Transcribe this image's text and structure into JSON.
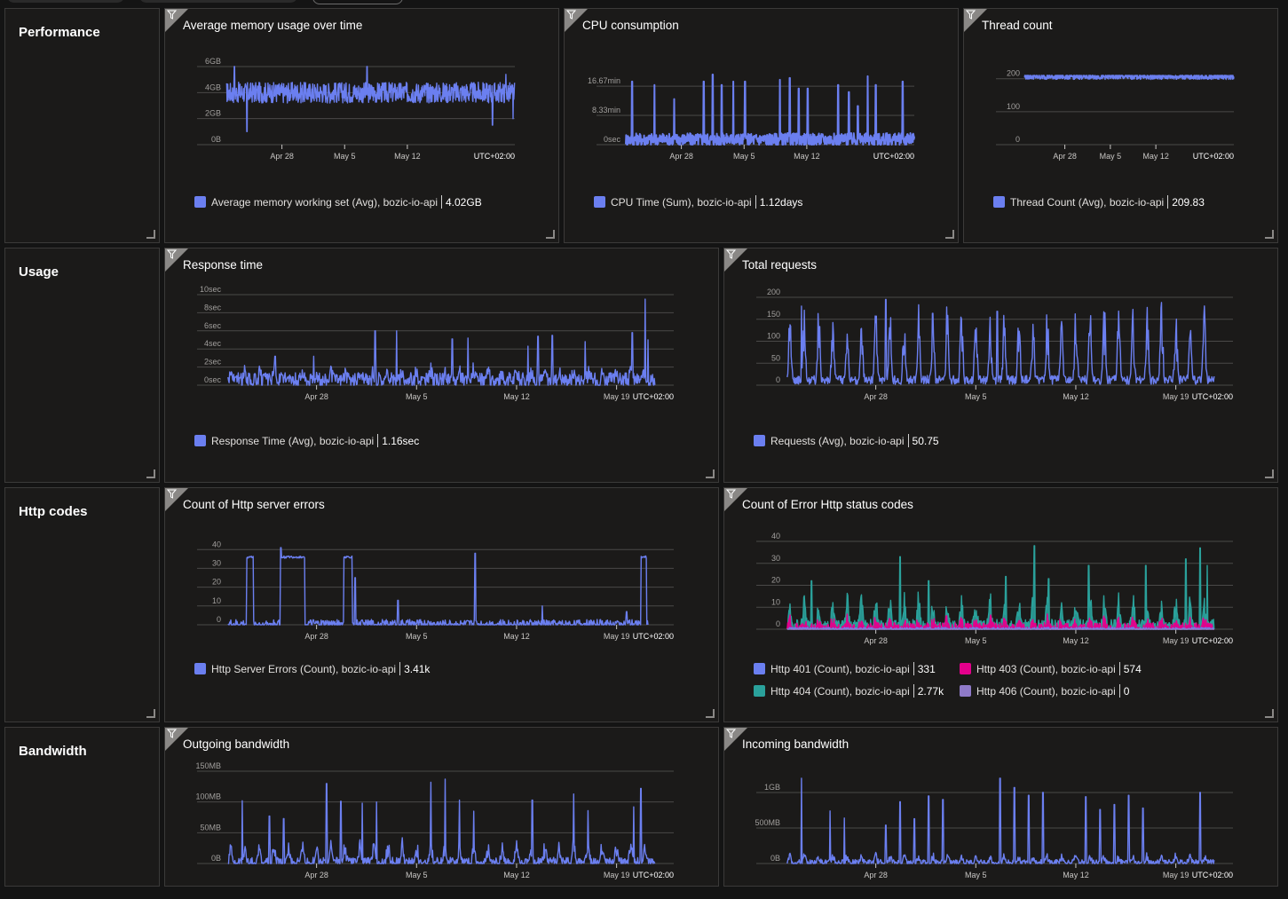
{
  "colors": {
    "series_blue": "#6b7ff0",
    "series_teal": "#2aa19b",
    "series_magenta": "#e3008c",
    "series_purple": "#8f7ac8",
    "gridline": "#4a4948",
    "panel_bg": "#1b1a19"
  },
  "sections": [
    {
      "label": "Performance"
    },
    {
      "label": "Usage"
    },
    {
      "label": "Http codes"
    },
    {
      "label": "Bandwidth"
    }
  ],
  "common": {
    "timezone_label": "UTC+02:00",
    "resource": "bozic-io-api",
    "filter_icon": "filter-icon",
    "resize_icon": "resize-handle-icon"
  },
  "chart_data": [
    {
      "id": "memory",
      "type": "line",
      "title": "Average memory usage over time",
      "xlabel": "",
      "ylabel": "",
      "x_ticks": [
        "Apr 28",
        "May 5",
        "May 12"
      ],
      "y_ticks": [
        "0B",
        "2GB",
        "4GB",
        "6GB"
      ],
      "ylim": [
        0,
        6
      ],
      "y_unit": "GB",
      "x_range_days": [
        0,
        31
      ],
      "x_tick_days": [
        6,
        13,
        20
      ],
      "legend_position": "bottom-left",
      "grid": true,
      "series": [
        {
          "name": "Average memory working set (Avg), bozic-io-api",
          "summary": "4.02GB",
          "color": "#6b7ff0",
          "profile": {
            "baseline": 4.0,
            "noise": 0.8,
            "spikes": [
              [
                1.2,
                6.3
              ],
              [
                2.6,
                1.0
              ],
              [
                16,
                6.3
              ],
              [
                30,
                1.5
              ],
              [
                31.5,
                5.4
              ],
              [
                32.3,
                2.0
              ]
            ],
            "end_day": 32.5
          }
        }
      ]
    },
    {
      "id": "cpu",
      "type": "line",
      "title": "CPU consumption",
      "x_ticks": [
        "Apr 28",
        "May 5",
        "May 12"
      ],
      "y_ticks": [
        "0sec",
        "8.33min",
        "16.67min"
      ],
      "ylim": [
        0,
        21
      ],
      "y_unit": "min",
      "x_tick_days": [
        6,
        13,
        20
      ],
      "legend_position": "bottom-left",
      "grid": true,
      "series": [
        {
          "name": "CPU Time (Sum), bozic-io-api",
          "summary": "1.12days",
          "color": "#6b7ff0",
          "profile": {
            "baseline": 1.5,
            "noise": 1.8,
            "spikes": [
              [
                1,
                18
              ],
              [
                3.5,
                17
              ],
              [
                5.7,
                13
              ],
              [
                9,
                18
              ],
              [
                10,
                20
              ],
              [
                11,
                17
              ],
              [
                12.3,
                18
              ],
              [
                13.6,
                18
              ],
              [
                17.5,
                18.5
              ],
              [
                18.6,
                19
              ],
              [
                19.6,
                16
              ],
              [
                20.6,
                16
              ],
              [
                24,
                17
              ],
              [
                25.2,
                15
              ],
              [
                26.2,
                11
              ],
              [
                27.3,
                19.5
              ],
              [
                28.2,
                17
              ],
              [
                31.2,
                18
              ]
            ],
            "end_day": 32.5
          }
        }
      ]
    },
    {
      "id": "threads",
      "type": "line",
      "title": "Thread count",
      "x_ticks": [
        "Apr 28",
        "May 5",
        "May 12"
      ],
      "y_ticks": [
        "0",
        "100",
        "200"
      ],
      "ylim": [
        0,
        210
      ],
      "x_tick_days": [
        6,
        13,
        20
      ],
      "legend_position": "bottom-left",
      "grid": true,
      "series": [
        {
          "name": "Thread Count (Avg), bozic-io-api",
          "summary": "209.83",
          "color": "#6b7ff0",
          "profile": {
            "baseline": 206,
            "noise": 8,
            "spikes": [],
            "end_day": 32.5
          }
        }
      ]
    },
    {
      "id": "response",
      "type": "line",
      "title": "Response time",
      "x_ticks": [
        "Apr 28",
        "May 5",
        "May 12",
        "May 19"
      ],
      "y_ticks": [
        "0sec",
        "2sec",
        "4sec",
        "6sec",
        "8sec",
        "10sec"
      ],
      "ylim": [
        0,
        10
      ],
      "y_unit": "sec",
      "x_tick_days": [
        6,
        13,
        20,
        27
      ],
      "legend_position": "bottom-left",
      "grid": true,
      "series": [
        {
          "name": "Response Time (Avg), bozic-io-api",
          "summary": "1.16sec",
          "color": "#6b7ff0",
          "profile": {
            "baseline": 0.6,
            "noise": 0.8,
            "spikes": [
              [
                3.6,
                3.2
              ],
              [
                6.3,
                3.2
              ],
              [
                10.6,
                6.0
              ],
              [
                12.1,
                6.0
              ],
              [
                16,
                5.1
              ],
              [
                17.1,
                5.2
              ],
              [
                21.3,
                4.3
              ],
              [
                22,
                5.4
              ],
              [
                23,
                5.5
              ],
              [
                25.3,
                4.8
              ],
              [
                28.6,
                5.8
              ],
              [
                29.5,
                9.5
              ],
              [
                29.7,
                5.0
              ]
            ],
            "daily_amp": 1.0,
            "end_day": 30.2
          }
        }
      ]
    },
    {
      "id": "requests",
      "type": "line",
      "title": "Total requests",
      "x_ticks": [
        "Apr 28",
        "May 5",
        "May 12",
        "May 19"
      ],
      "y_ticks": [
        "0",
        "50",
        "100",
        "150",
        "200"
      ],
      "ylim": [
        0,
        200
      ],
      "x_tick_days": [
        6,
        13,
        20,
        27
      ],
      "legend_position": "bottom-left",
      "grid": true,
      "series": [
        {
          "name": "Requests (Avg), bozic-io-api",
          "summary": "50.75",
          "color": "#6b7ff0",
          "profile": {
            "baseline": 12,
            "noise": 10,
            "daily_amp": 150,
            "spikes": [
              [
                1.3,
                180
              ],
              [
                7.2,
                195
              ],
              [
                15,
                168
              ]
            ],
            "end_day": 30.2
          }
        }
      ]
    },
    {
      "id": "server_errors",
      "type": "line",
      "title": "Count of Http server errors",
      "x_ticks": [
        "Apr 28",
        "May 5",
        "May 12",
        "May 19"
      ],
      "y_ticks": [
        "0",
        "10",
        "20",
        "30",
        "40"
      ],
      "ylim": [
        0,
        42
      ],
      "x_tick_days": [
        6,
        13,
        20,
        27
      ],
      "legend_position": "bottom-left",
      "grid": true,
      "series": [
        {
          "name": "Http Server Errors (Count), bozic-io-api",
          "summary": "3.41k",
          "color": "#6b7ff0",
          "profile": {
            "baseline": 0.3,
            "noise": 2.5,
            "plateaus": [
              [
                1.6,
                2.1,
                36
              ],
              [
                4.0,
                5.7,
                36
              ],
              [
                8.4,
                9.0,
                36
              ],
              [
                29.2,
                29.6,
                36
              ]
            ],
            "spikes": [
              [
                4.0,
                41
              ],
              [
                9.2,
                25
              ],
              [
                12.2,
                13
              ],
              [
                17.6,
                38
              ],
              [
                22.3,
                10
              ],
              [
                28.2,
                7
              ]
            ],
            "end_day": 29.7
          }
        }
      ]
    },
    {
      "id": "error_codes",
      "type": "line",
      "title": "Count of Error Http status codes",
      "x_ticks": [
        "Apr 28",
        "May 5",
        "May 12",
        "May 19"
      ],
      "y_ticks": [
        "0",
        "10",
        "20",
        "30",
        "40"
      ],
      "ylim": [
        0,
        40
      ],
      "x_tick_days": [
        6,
        13,
        20,
        27
      ],
      "legend_position": "bottom-left",
      "grid": true,
      "series": [
        {
          "name": "Http 401 (Count), bozic-io-api",
          "summary": "331",
          "color": "#6b7ff0",
          "profile": {
            "baseline": 0.2,
            "noise": 0.6,
            "spikes": [],
            "end_day": 30.2
          }
        },
        {
          "name": "Http 403 (Count), bozic-io-api",
          "summary": "574",
          "color": "#e3008c",
          "profile": {
            "baseline": 0.4,
            "noise": 2.5,
            "daily_amp": 4,
            "spikes": [],
            "end_day": 30.2
          }
        },
        {
          "name": "Http 404 (Count), bozic-io-api",
          "summary": "2.77k",
          "color": "#2aa19b",
          "profile": {
            "baseline": 1.5,
            "noise": 3,
            "daily_amp": 12,
            "spikes": [
              [
                8.2,
                33
              ],
              [
                17.6,
                38
              ],
              [
                18.6,
                23
              ],
              [
                15.6,
                24
              ],
              [
                29.2,
                37
              ],
              [
                28.2,
                32
              ],
              [
                29.7,
                29
              ],
              [
                21.4,
                29
              ],
              [
                25.4,
                29
              ],
              [
                2.0,
                22
              ],
              [
                10.2,
                22
              ]
            ],
            "end_day": 30.2
          }
        },
        {
          "name": "Http 406 (Count), bozic-io-api",
          "summary": "0",
          "color": "#8f7ac8",
          "profile": {
            "baseline": 0,
            "noise": 0,
            "spikes": [],
            "end_day": 30.2
          }
        }
      ]
    },
    {
      "id": "outgoing",
      "type": "line",
      "title": "Outgoing bandwidth",
      "x_ticks": [
        "Apr 28",
        "May 5",
        "May 12",
        "May 19"
      ],
      "y_ticks": [
        "0B",
        "50MB",
        "100MB",
        "150MB"
      ],
      "ylim": [
        0,
        150
      ],
      "y_unit": "MB",
      "x_tick_days": [
        6,
        13,
        20,
        27
      ],
      "legend_position": "bottom-left",
      "grid": true,
      "series": [
        {
          "name": "Outgoing bandwidth",
          "summary": "",
          "color": "#6b7ff0",
          "profile": {
            "baseline": 2,
            "noise": 8,
            "daily_amp": 30,
            "spikes": [
              [
                1.3,
                102
              ],
              [
                3.2,
                77
              ],
              [
                4.2,
                73
              ],
              [
                7.2,
                130
              ],
              [
                8.2,
                101
              ],
              [
                9.7,
                98
              ],
              [
                10.7,
                100
              ],
              [
                14.5,
                132
              ],
              [
                15.5,
                137
              ],
              [
                16.5,
                103
              ],
              [
                17.5,
                85
              ],
              [
                21.6,
                103
              ],
              [
                24.5,
                113
              ],
              [
                25.5,
                86
              ],
              [
                29.2,
                122
              ],
              [
                28.7,
                92
              ]
            ],
            "end_day": 30.2
          }
        }
      ]
    },
    {
      "id": "incoming",
      "type": "line",
      "title": "Incoming bandwidth",
      "x_ticks": [
        "Apr 28",
        "May 5",
        "May 12",
        "May 19"
      ],
      "y_ticks": [
        "0B",
        "500MB",
        "1GB"
      ],
      "ylim": [
        0,
        1200
      ],
      "y_unit": "MB",
      "x_tick_days": [
        6,
        13,
        20,
        27
      ],
      "legend_position": "bottom-left",
      "grid": true,
      "series": [
        {
          "name": "Incoming bandwidth",
          "summary": "",
          "color": "#6b7ff0",
          "profile": {
            "baseline": 15,
            "noise": 40,
            "daily_amp": 100,
            "spikes": [
              [
                1.3,
                1200
              ],
              [
                3.3,
                740
              ],
              [
                4.3,
                640
              ],
              [
                7.2,
                540
              ],
              [
                8.2,
                870
              ],
              [
                9.2,
                630
              ],
              [
                10.2,
                950
              ],
              [
                11.2,
                900
              ],
              [
                15.2,
                1220
              ],
              [
                16.2,
                1070
              ],
              [
                17.2,
                960
              ],
              [
                18.2,
                1000
              ],
              [
                21.2,
                940
              ],
              [
                22.2,
                760
              ],
              [
                23.2,
                830
              ],
              [
                24.2,
                960
              ],
              [
                25.2,
                780
              ],
              [
                29.2,
                1000
              ]
            ],
            "end_day": 30.2
          }
        }
      ]
    }
  ]
}
